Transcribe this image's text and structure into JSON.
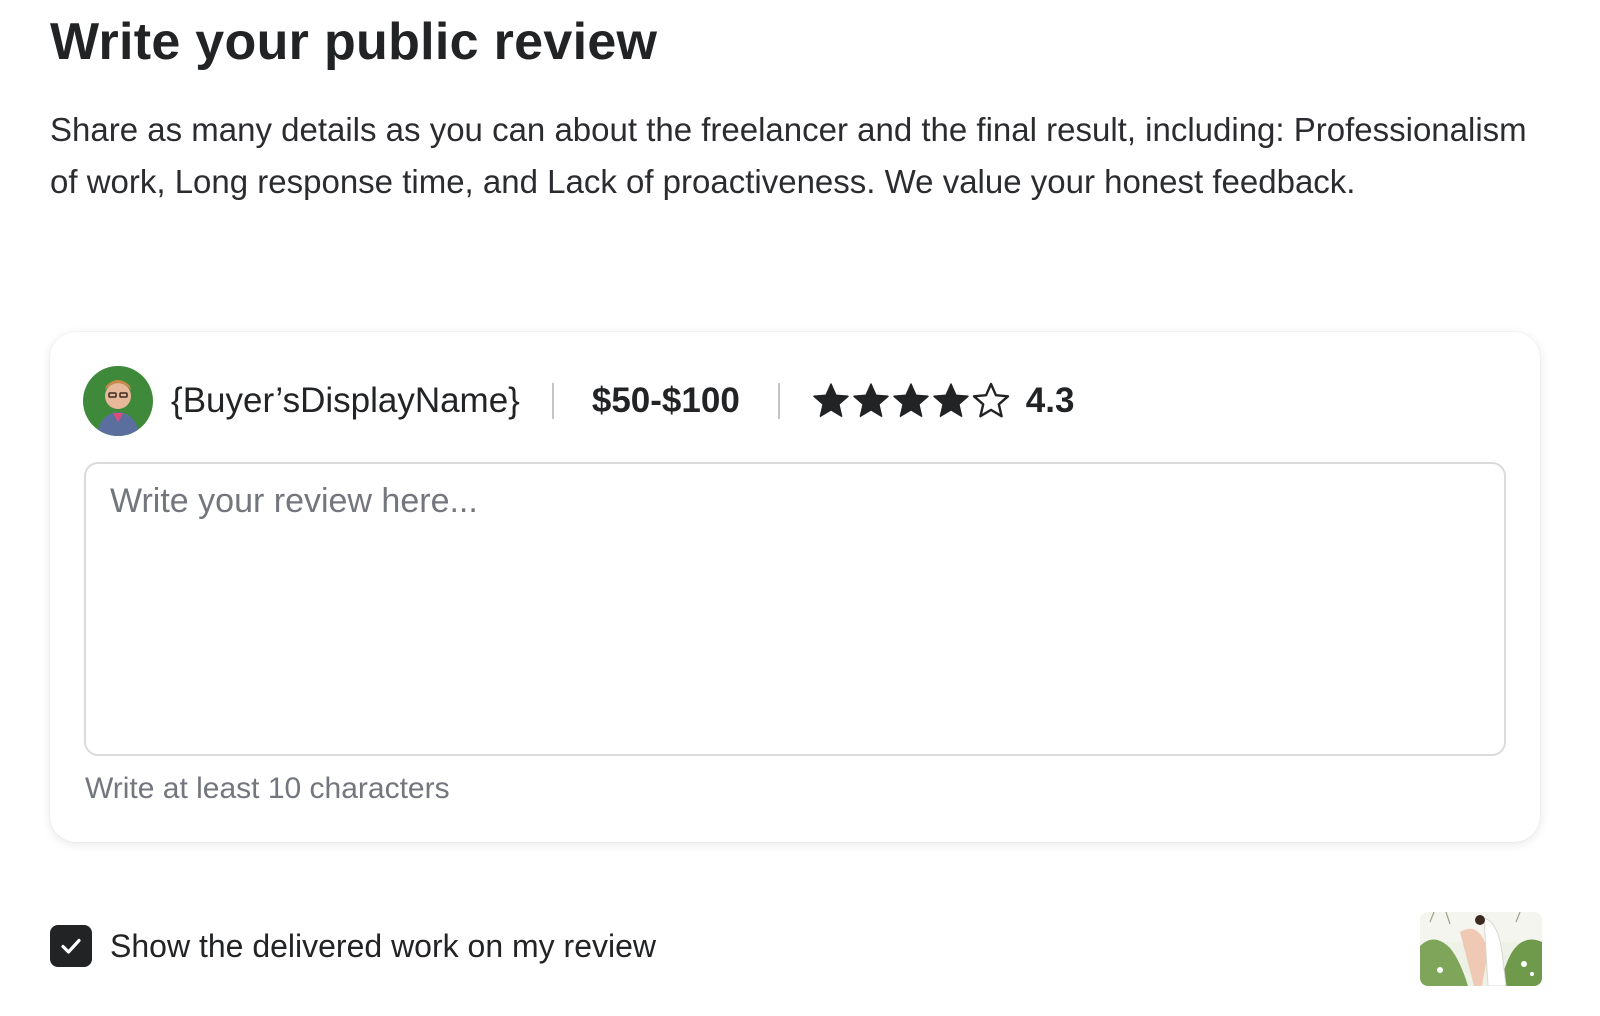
{
  "header": {
    "title": "Write your public review",
    "description": "Share as many details as you can about the freelancer and the final result, including: Professionalism of work, Long response time, and Lack of proactiveness. We value your honest feedback."
  },
  "review_card": {
    "avatar_icon": "buyer-avatar",
    "buyer_name": "{Buyer’sDisplayName}",
    "budget": "$50-$100",
    "rating": {
      "filled_stars": 4,
      "total_stars": 5,
      "value": "4.3"
    },
    "review_input": {
      "value": "",
      "placeholder": "Write your review here..."
    },
    "hint": "Write at least 10 characters"
  },
  "delivered_work": {
    "checked": true,
    "label": "Show the delivered work on my review",
    "thumbnail_icon": "delivered-work-thumbnail"
  },
  "colors": {
    "text_primary": "#222325",
    "text_muted": "#74767e",
    "border": "#dadbdd",
    "checkbox_fill": "#222325",
    "avatar_bg": "#3f8a3a"
  }
}
